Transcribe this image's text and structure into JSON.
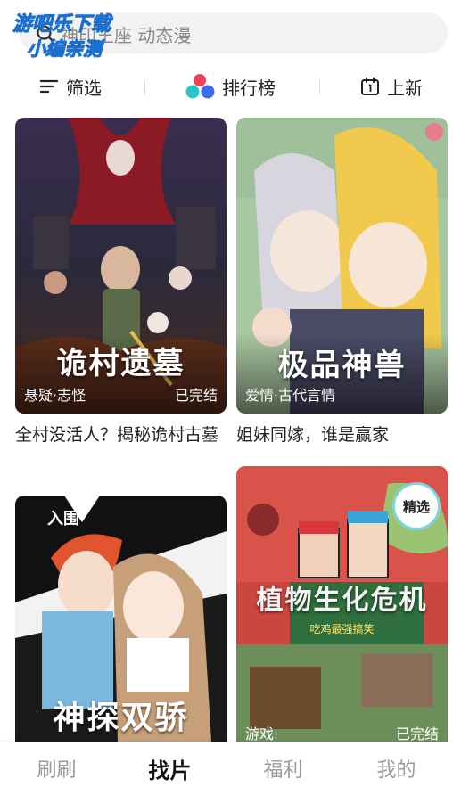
{
  "search": {
    "placeholder": "神印王座 动态漫"
  },
  "watermark": {
    "line1": "游吧乐下载",
    "line2": "小编亲测"
  },
  "filters": [
    {
      "label": "筛选",
      "icon": "filter-lines-icon"
    },
    {
      "label": "排行榜",
      "icon": "ranking-dots-icon"
    },
    {
      "label": "上新",
      "icon": "calendar-icon"
    }
  ],
  "cards": [
    {
      "cover_title": "诡村遗墓",
      "genre": "悬疑·志怪",
      "status": "已完结",
      "description": "全村没活人？揭秘诡村古墓"
    },
    {
      "cover_title": "极品神兽",
      "genre": "爱情·古代言情",
      "status": "",
      "description": "姐妹同嫁，谁是赢家"
    },
    {
      "cover_title": "神探双骄",
      "badge": "入围",
      "genre": "",
      "status": "",
      "description": ""
    },
    {
      "cover_title": "植物生化危机",
      "subtitle": "吃鸡最强搞笑",
      "badge": "精选",
      "genre": "游戏·",
      "status": "已完结",
      "description": ""
    }
  ],
  "nav": [
    {
      "label": "刷刷",
      "active": false
    },
    {
      "label": "找片",
      "active": true
    },
    {
      "label": "福利",
      "active": false
    },
    {
      "label": "我的",
      "active": false
    }
  ],
  "colors": {
    "watermark_fill": "#5fd3ff",
    "ranking_red": "#f0415a",
    "ranking_teal": "#27c4c9",
    "ranking_blue": "#3b6cf0",
    "active_tab": "#111111",
    "inactive_tab": "#9a9a9a"
  }
}
